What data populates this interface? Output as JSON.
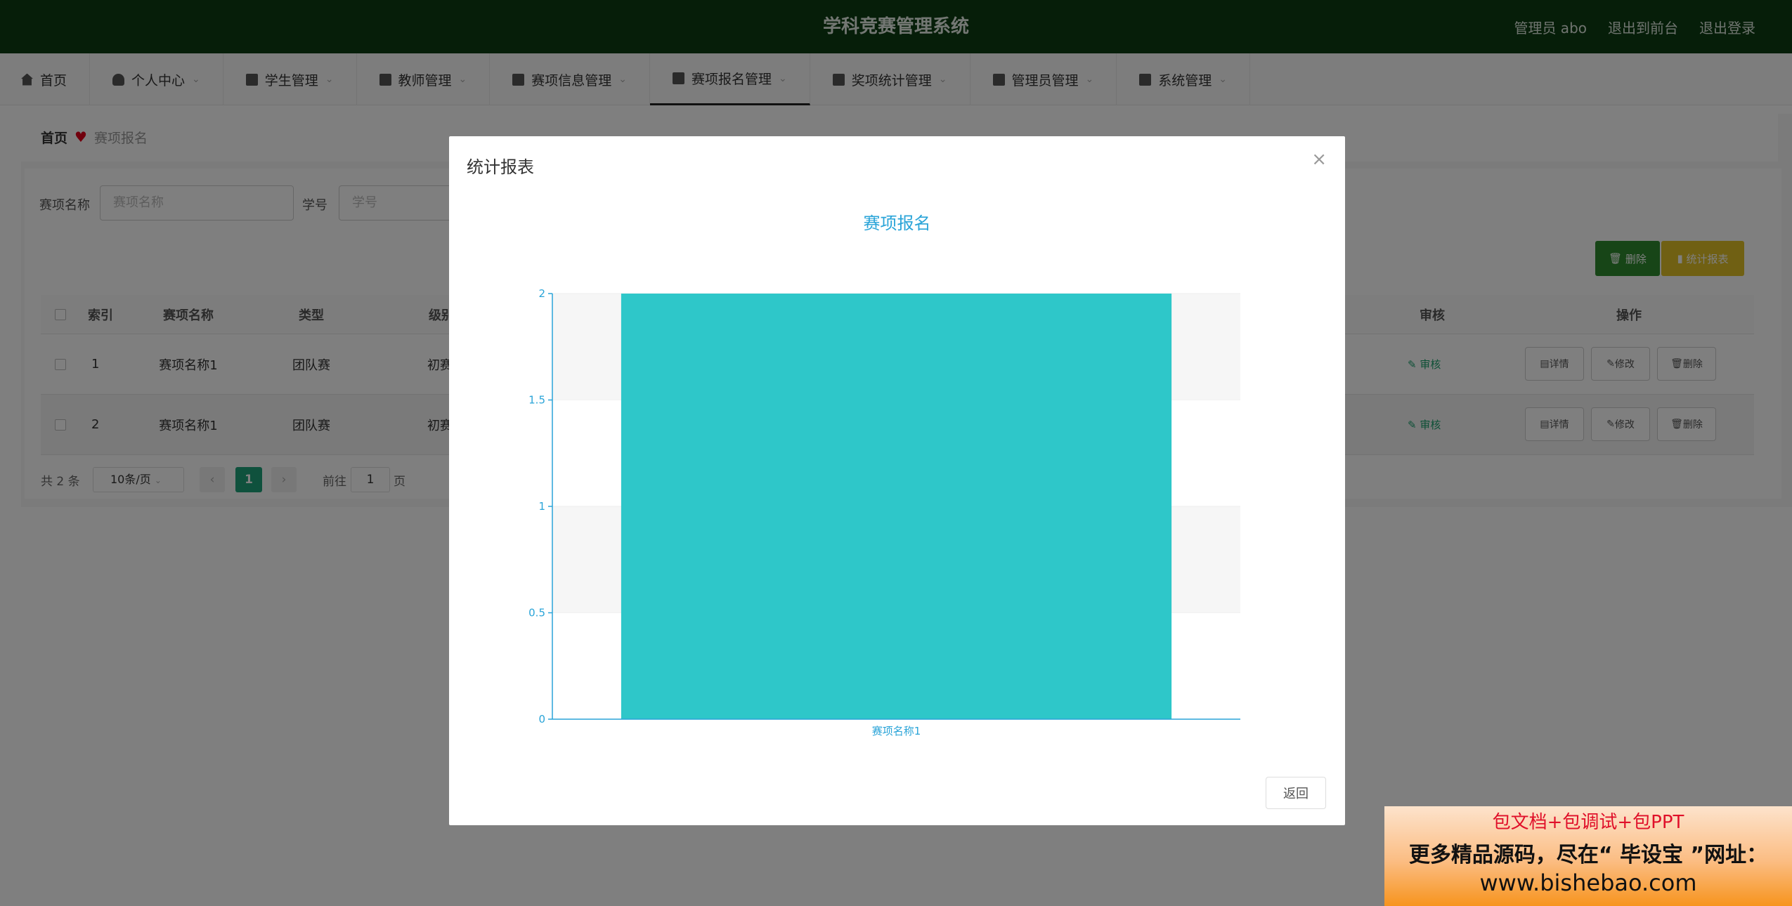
{
  "header": {
    "title": "学科竞赛管理系统",
    "admin_label": "管理员 abo",
    "to_front": "退出到前台",
    "logout": "退出登录"
  },
  "menu": [
    {
      "label": "首页",
      "icon": "home-icon"
    },
    {
      "label": "个人中心",
      "icon": "user-icon"
    },
    {
      "label": "学生管理",
      "icon": "student-icon"
    },
    {
      "label": "教师管理",
      "icon": "teacher-icon"
    },
    {
      "label": "赛项信息管理",
      "icon": "clipboard-icon"
    },
    {
      "label": "赛项报名管理",
      "icon": "briefcase-icon"
    },
    {
      "label": "奖项统计管理",
      "icon": "award-icon"
    },
    {
      "label": "管理员管理",
      "icon": "grid-icon"
    },
    {
      "label": "系统管理",
      "icon": "sliders-icon"
    }
  ],
  "breadcrumb": {
    "home": "首页",
    "current": "赛项报名"
  },
  "search": {
    "name_label": "赛项名称",
    "name_placeholder": "赛项名称",
    "sid_label": "学号",
    "sid_placeholder": "学号"
  },
  "toolbar": {
    "delete": "删除",
    "stats": "统计报表"
  },
  "table": {
    "headers": [
      "索引",
      "赛项名称",
      "类型",
      "级别",
      "审核",
      "操作"
    ],
    "rows": [
      {
        "index": "1",
        "name": "赛项名称1",
        "type": "团队赛",
        "level": "初赛",
        "audit": "审核"
      },
      {
        "index": "2",
        "name": "赛项名称1",
        "type": "团队赛",
        "level": "初赛",
        "audit": "审核"
      }
    ],
    "ops": {
      "detail": "详情",
      "edit": "修改",
      "delete": "删除"
    }
  },
  "pagination": {
    "total": "共 2 条",
    "page_size": "10条/页",
    "current": "1",
    "goto_prefix": "前往",
    "goto_value": "1",
    "goto_suffix": "页"
  },
  "modal": {
    "title": "统计报表",
    "return": "返回"
  },
  "chart_data": {
    "type": "bar",
    "title": "赛项报名",
    "categories": [
      "赛项名称1"
    ],
    "values": [
      2
    ],
    "ylim": [
      0,
      2
    ],
    "yticks": [
      "0",
      "0.5",
      "1",
      "1.5",
      "2"
    ],
    "bar_color": "#2ec7c9",
    "axis_color": "#2aa4d8",
    "grid": "alternating bands"
  },
  "promo": {
    "line1": "包文档+包调试+包PPT",
    "line2": "更多精品源码，尽在“ 毕设宝 ”网址：",
    "line3": "www.bishebao.com"
  }
}
